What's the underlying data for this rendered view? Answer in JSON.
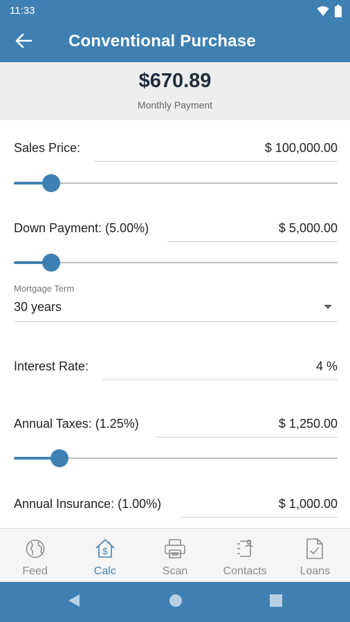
{
  "status_bar": {
    "time": "11:33"
  },
  "app_bar": {
    "title": "Conventional Purchase"
  },
  "payment": {
    "amount": "$670.89",
    "label": "Monthly Payment"
  },
  "sales_price": {
    "label": "Sales Price:",
    "value": "$ 100,000.00",
    "slider_level": 0.115
  },
  "down_payment": {
    "label": "Down Payment: (5.00%)",
    "value": "$ 5,000.00",
    "slider_level": 0.115
  },
  "mortgage_term": {
    "caption": "Mortgage Term",
    "value": "30 years"
  },
  "interest_rate": {
    "label": "Interest Rate:",
    "value": "4 %"
  },
  "annual_taxes": {
    "label": "Annual Taxes: (1.25%)",
    "value": "$ 1,250.00",
    "slider_level": 0.14
  },
  "annual_insurance": {
    "label": "Annual Insurance: (1.00%)",
    "value": "$ 1,000.00"
  },
  "bottom_nav": {
    "items": [
      {
        "label": "Feed",
        "icon": "globe-icon",
        "active": false
      },
      {
        "label": "Calc",
        "icon": "house-dollar-icon",
        "active": true
      },
      {
        "label": "Scan",
        "icon": "printer-icon",
        "active": false
      },
      {
        "label": "Contacts",
        "icon": "contacts-icon",
        "active": false
      },
      {
        "label": "Loans",
        "icon": "document-check-icon",
        "active": false
      }
    ]
  },
  "colors": {
    "primary": "#3f80b3",
    "header_bg": "#eeeeee",
    "nav_inactive": "#8c8c8c",
    "amount": "#1f2d3d"
  }
}
